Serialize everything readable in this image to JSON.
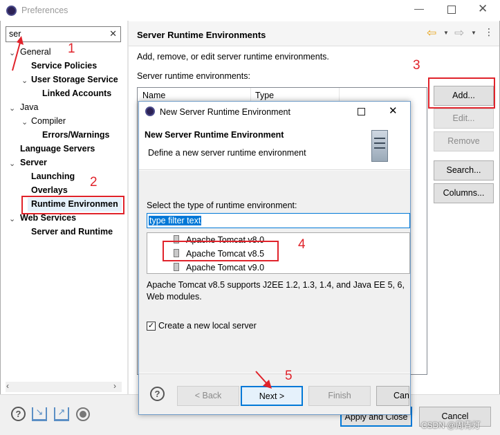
{
  "window": {
    "title": "Preferences"
  },
  "search": {
    "value": "ser"
  },
  "tree": {
    "items": [
      {
        "label": "General"
      },
      {
        "label": "Service Policies"
      },
      {
        "label": "User Storage Service"
      },
      {
        "label": "Linked Accounts"
      },
      {
        "label": "Java"
      },
      {
        "label": "Compiler"
      },
      {
        "label": "Errors/Warnings"
      },
      {
        "label": "Language Servers"
      },
      {
        "label": "Server"
      },
      {
        "label": "Launching"
      },
      {
        "label": "Overlays"
      },
      {
        "label": "Runtime Environmen"
      },
      {
        "label": "Web Services"
      },
      {
        "label": "Server and Runtime"
      }
    ]
  },
  "page": {
    "title": "Server Runtime Environments",
    "description": "Add, remove, or edit server runtime environments.",
    "table_label": "Server runtime environments:",
    "columns": [
      "Name",
      "Type"
    ],
    "buttons": {
      "add": "Add...",
      "edit": "Edit...",
      "remove": "Remove",
      "search": "Search...",
      "columns": "Columns..."
    },
    "apply_close": "Apply and Close",
    "cancel": "Cancel"
  },
  "dialog": {
    "title": "New Server Runtime Environment",
    "header_title": "New Server Runtime Environment",
    "header_desc": "Define a new server runtime environment",
    "select_label": "Select the type of runtime environment:",
    "filter_value": "type filter text",
    "runtimes": [
      "Apache Tomcat v8.0",
      "Apache Tomcat v8.5",
      "Apache Tomcat v9.0"
    ],
    "runtime_desc_1": "Apache Tomcat v8.5 supports J2EE 1.2, 1.3, 1.4, and Java EE 5, 6,",
    "runtime_desc_2": "Web modules.",
    "create_server_label": "Create a new local server",
    "create_server_checked": true,
    "buttons": {
      "back": "< Back",
      "next": "Next >",
      "finish": "Finish",
      "cancel": "Can"
    }
  },
  "annotations": [
    "1",
    "2",
    "3",
    "4",
    "5"
  ],
  "watermark": "CSDN @周青灯",
  "colors": {
    "annotation": "#e0222a",
    "selection": "#0078d7"
  }
}
